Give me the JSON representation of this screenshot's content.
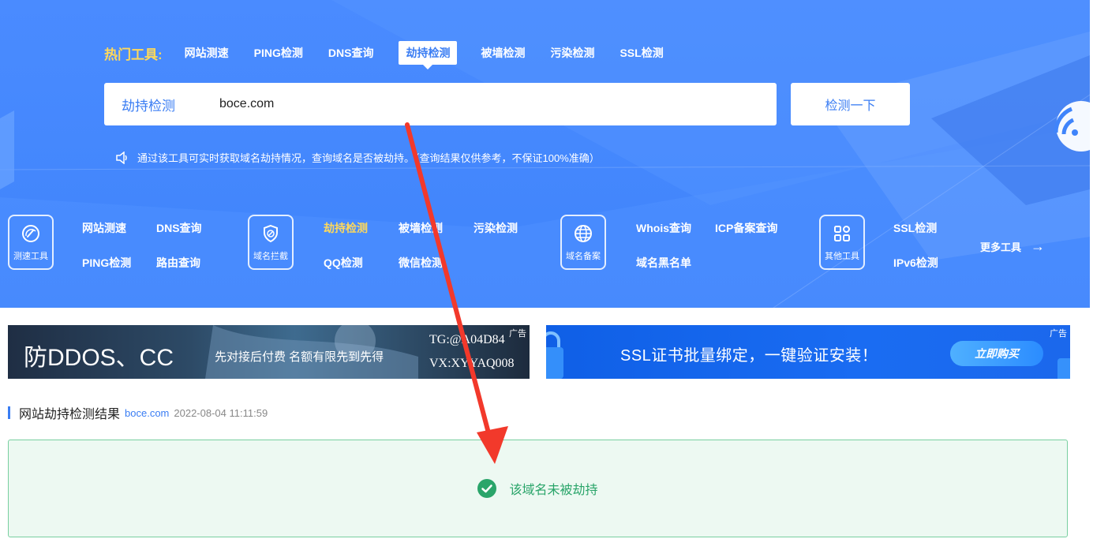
{
  "hot_tools": {
    "label": "热门工具:",
    "links": [
      "网站测速",
      "PING检测",
      "DNS查询",
      "劫持检测",
      "被墙检测",
      "污染检测",
      "SSL检测"
    ],
    "active": "劫持检测"
  },
  "search": {
    "type_label": "劫持检测",
    "value": "boce.com",
    "button": "检测一下"
  },
  "tip": "通过该工具可实时获取域名劫持情况，查询域名是否被劫持。（查询结果仅供参考，不保证100%准确）",
  "categories": [
    {
      "name": "测速工具",
      "icon": "speedometer-icon",
      "links": [
        "网站测速",
        "DNS查询",
        "PING检测",
        "路由查询"
      ]
    },
    {
      "name": "域名拦截",
      "icon": "shield-icon",
      "links": [
        "劫持检测",
        "被墙检测",
        "污染检测",
        "QQ检测",
        "微信检测"
      ]
    },
    {
      "name": "域名备案",
      "icon": "globe-icon",
      "links": [
        "Whois查询",
        "ICP备案查询",
        "域名黑名单"
      ]
    },
    {
      "name": "其他工具",
      "icon": "grid-icon",
      "links": [
        "SSL检测",
        "IPv6检测"
      ]
    }
  ],
  "more_tools": "更多工具",
  "ads": {
    "ad1": {
      "title": "防DDOS、CC",
      "sub": "先对接后付费 名额有限先到先得",
      "line1": "TG:@A04D84",
      "line2": "VX:XYYAQ008",
      "tag": "广告"
    },
    "ad2": {
      "title": "SSL证书批量绑定，一键验证安装！",
      "button": "立即购买",
      "tag": "广告"
    }
  },
  "result": {
    "title": "网站劫持检测结果",
    "domain": "boce.com",
    "time": "2022-08-04 11:11:59",
    "message": "该域名未被劫持"
  },
  "colors": {
    "hero": "#4a8bff",
    "accent": "#3a7df3",
    "highlight": "#ffd95a",
    "success": "#2aa56a"
  }
}
